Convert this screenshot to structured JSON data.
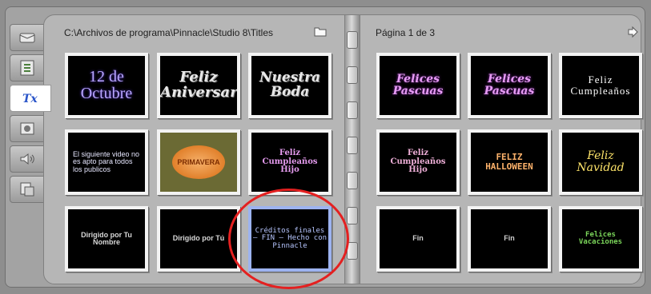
{
  "toolbar": {
    "tools": [
      {
        "icon": "video-icon",
        "active": false
      },
      {
        "icon": "transitions-icon",
        "active": false
      },
      {
        "icon": "titles-icon",
        "active": true
      },
      {
        "icon": "photo-icon",
        "active": false
      },
      {
        "icon": "sound-effects-icon",
        "active": false
      },
      {
        "icon": "menus-icon",
        "active": false
      }
    ]
  },
  "left_page": {
    "path": "C:\\Archivos de programa\\Pinnacle\\Studio 8\\Titles",
    "folder_icon": "folder-icon",
    "titles": [
      {
        "text": "12 de Octubre"
      },
      {
        "text": "Feliz Aniversario"
      },
      {
        "text": "Nuestra Boda"
      },
      {
        "text": "El siguiente video no es apto para todos los publicos"
      },
      {
        "text": "PRIMAVERA"
      },
      {
        "text": "Feliz Cumpleaños Hijo"
      },
      {
        "text": "Dirigido por Tu Nombre"
      },
      {
        "text": "Dirigido por Tú"
      },
      {
        "text": "Créditos finales — FIN — Hecho con Pinnacle"
      }
    ]
  },
  "right_page": {
    "page_label": "Página 1 de 3",
    "next_icon": "arrow-right-icon",
    "titles": [
      {
        "text": "Felices Pascuas"
      },
      {
        "text": "Felices Pascuas"
      },
      {
        "text": "Feliz Cumpleaños"
      },
      {
        "text": "Feliz Cumpleaños Hijo"
      },
      {
        "text": "FELIZ HALLOWEEN"
      },
      {
        "text": "Feliz Navidad"
      },
      {
        "text": "Fin"
      },
      {
        "text": "Fin"
      },
      {
        "text": "Felices Vacaciones"
      }
    ]
  },
  "accent_color": "#e42020",
  "selection_color": "#9db3f0"
}
